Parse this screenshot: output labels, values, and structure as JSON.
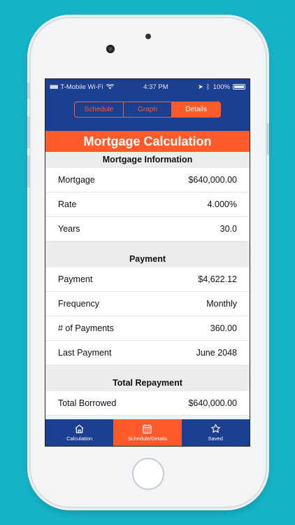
{
  "status_bar": {
    "carrier": "T-Mobile Wi-Fi",
    "time": "4:37 PM",
    "battery": "100%"
  },
  "segments": [
    "Schedule",
    "Graph",
    "Details"
  ],
  "active_segment": "Details",
  "title": "Mortgage Calculation",
  "sections": [
    {
      "heading": "Mortgage Information",
      "rows": [
        {
          "label": "Mortgage",
          "value": "$640,000.00"
        },
        {
          "label": "Rate",
          "value": "4.000%"
        },
        {
          "label": "Years",
          "value": "30.0"
        }
      ]
    },
    {
      "heading": "Payment",
      "rows": [
        {
          "label": "Payment",
          "value": "$4,622.12"
        },
        {
          "label": "Frequency",
          "value": "Monthly"
        },
        {
          "label": "# of Payments",
          "value": "360.00"
        },
        {
          "label": "Last Payment",
          "value": "June 2048"
        }
      ]
    },
    {
      "heading": "Total Repayment",
      "rows": [
        {
          "label": "Total Borrowed",
          "value": "$640,000.00"
        }
      ]
    }
  ],
  "tabs": [
    {
      "label": "Calculation",
      "icon": "home-icon"
    },
    {
      "label": "Schedule/Details",
      "icon": "calendar-icon"
    },
    {
      "label": "Saved",
      "icon": "star-icon"
    }
  ],
  "colors": {
    "navy": "#1c3f92",
    "accent": "#ff5a2a",
    "background": "#16b4c9"
  }
}
